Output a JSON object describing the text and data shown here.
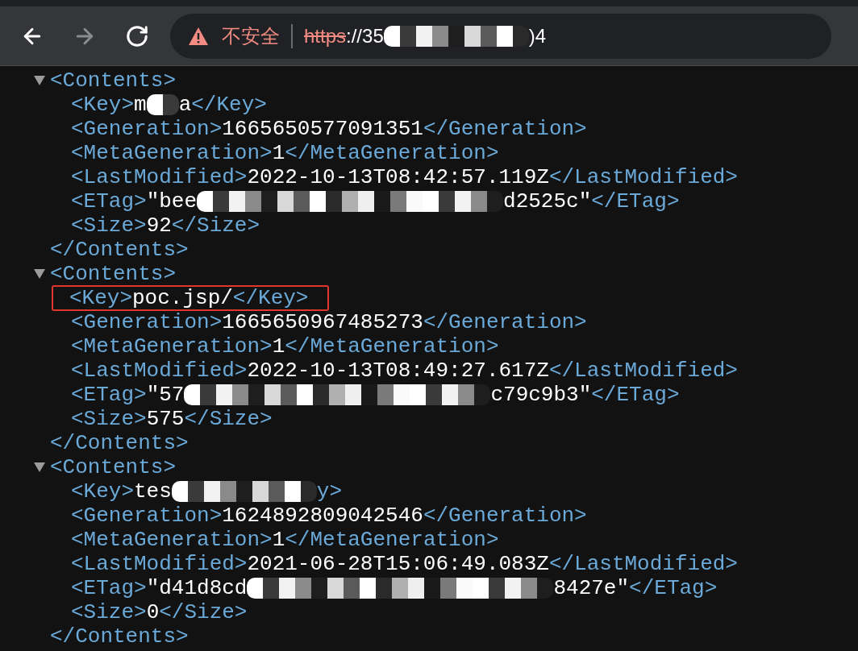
{
  "toolbar": {
    "buttons": [
      {
        "kind": "back",
        "disabled": false
      },
      {
        "kind": "forward",
        "disabled": true
      },
      {
        "kind": "reload",
        "disabled": false
      }
    ],
    "address": {
      "security_label": "不安全",
      "scheme": "https",
      "segments": [
        {
          "kind": "text",
          "text": "://35"
        },
        {
          "kind": "medium_redaction"
        },
        {
          "kind": "text",
          "text": ")4"
        }
      ]
    }
  },
  "nodes": [
    {
      "expanded": true,
      "open_tag": "<Contents>",
      "close_tag": "</Contents>",
      "lines": [
        {
          "highlighted": false,
          "segments": [
            {
              "kind": "tag",
              "text": "<Key>"
            },
            {
              "kind": "value",
              "text": "m"
            },
            {
              "kind": "short_redaction"
            },
            {
              "kind": "value",
              "text": "a"
            },
            {
              "kind": "tag",
              "text": "</Key>"
            }
          ]
        },
        {
          "highlighted": false,
          "segments": [
            {
              "kind": "tag",
              "text": "<Generation>"
            },
            {
              "kind": "value",
              "text": "1665650577091351"
            },
            {
              "kind": "tag",
              "text": "</Generation>"
            }
          ]
        },
        {
          "highlighted": false,
          "segments": [
            {
              "kind": "tag",
              "text": "<MetaGeneration>"
            },
            {
              "kind": "value",
              "text": "1"
            },
            {
              "kind": "tag",
              "text": "</MetaGeneration>"
            }
          ]
        },
        {
          "highlighted": false,
          "segments": [
            {
              "kind": "tag",
              "text": "<LastModified>"
            },
            {
              "kind": "value",
              "text": "2022-10-13T08:42:57.119Z"
            },
            {
              "kind": "tag",
              "text": "</LastModified>"
            }
          ]
        },
        {
          "highlighted": false,
          "segments": [
            {
              "kind": "tag",
              "text": "<ETag>"
            },
            {
              "kind": "value",
              "text": "\"bee"
            },
            {
              "kind": "long_redaction"
            },
            {
              "kind": "value",
              "text": "d2525c\""
            },
            {
              "kind": "tag",
              "text": "</ETag>"
            }
          ]
        },
        {
          "highlighted": false,
          "segments": [
            {
              "kind": "tag",
              "text": "<Size>"
            },
            {
              "kind": "value",
              "text": "92"
            },
            {
              "kind": "tag",
              "text": "</Size>"
            }
          ]
        }
      ]
    },
    {
      "expanded": true,
      "open_tag": "<Contents>",
      "close_tag": "</Contents>",
      "lines": [
        {
          "highlighted": true,
          "segments": [
            {
              "kind": "tag",
              "text": "<Key>"
            },
            {
              "kind": "value",
              "text": "poc.jsp/"
            },
            {
              "kind": "tag",
              "text": "</Key>"
            }
          ]
        },
        {
          "highlighted": false,
          "segments": [
            {
              "kind": "tag",
              "text": "<Generation>"
            },
            {
              "kind": "value",
              "text": "1665650967485273"
            },
            {
              "kind": "tag",
              "text": "</Generation>"
            }
          ]
        },
        {
          "highlighted": false,
          "segments": [
            {
              "kind": "tag",
              "text": "<MetaGeneration>"
            },
            {
              "kind": "value",
              "text": "1"
            },
            {
              "kind": "tag",
              "text": "</MetaGeneration>"
            }
          ]
        },
        {
          "highlighted": false,
          "segments": [
            {
              "kind": "tag",
              "text": "<LastModified>"
            },
            {
              "kind": "value",
              "text": "2022-10-13T08:49:27.617Z"
            },
            {
              "kind": "tag",
              "text": "</LastModified>"
            }
          ]
        },
        {
          "highlighted": false,
          "segments": [
            {
              "kind": "tag",
              "text": "<ETag>"
            },
            {
              "kind": "value",
              "text": "\"57"
            },
            {
              "kind": "long_redaction"
            },
            {
              "kind": "value",
              "text": "c79c9b3\""
            },
            {
              "kind": "tag",
              "text": "</ETag>"
            }
          ]
        },
        {
          "highlighted": false,
          "segments": [
            {
              "kind": "tag",
              "text": "<Size>"
            },
            {
              "kind": "value",
              "text": "575"
            },
            {
              "kind": "tag",
              "text": "</Size>"
            }
          ]
        }
      ]
    },
    {
      "expanded": true,
      "open_tag": "<Contents>",
      "close_tag": "</Contents>",
      "lines": [
        {
          "highlighted": false,
          "segments": [
            {
              "kind": "tag",
              "text": "<Key>"
            },
            {
              "kind": "value",
              "text": "tes"
            },
            {
              "kind": "medium_redaction"
            },
            {
              "kind": "tag",
              "text": "y>"
            }
          ]
        },
        {
          "highlighted": false,
          "segments": [
            {
              "kind": "tag",
              "text": "<Generation>"
            },
            {
              "kind": "value",
              "text": "1624892809042546"
            },
            {
              "kind": "tag",
              "text": "</Generation>"
            }
          ]
        },
        {
          "highlighted": false,
          "segments": [
            {
              "kind": "tag",
              "text": "<MetaGeneration>"
            },
            {
              "kind": "value",
              "text": "1"
            },
            {
              "kind": "tag",
              "text": "</MetaGeneration>"
            }
          ]
        },
        {
          "highlighted": false,
          "segments": [
            {
              "kind": "tag",
              "text": "<LastModified>"
            },
            {
              "kind": "value",
              "text": "2021-06-28T15:06:49.083Z"
            },
            {
              "kind": "tag",
              "text": "</LastModified>"
            }
          ]
        },
        {
          "highlighted": false,
          "segments": [
            {
              "kind": "tag",
              "text": "<ETag>"
            },
            {
              "kind": "value",
              "text": "\"d41d8cd"
            },
            {
              "kind": "long_redaction"
            },
            {
              "kind": "value",
              "text": "8427e\""
            },
            {
              "kind": "tag",
              "text": "</ETag>"
            }
          ]
        },
        {
          "highlighted": false,
          "segments": [
            {
              "kind": "tag",
              "text": "<Size>"
            },
            {
              "kind": "value",
              "text": "0"
            },
            {
              "kind": "tag",
              "text": "</Size>"
            }
          ]
        }
      ]
    }
  ]
}
